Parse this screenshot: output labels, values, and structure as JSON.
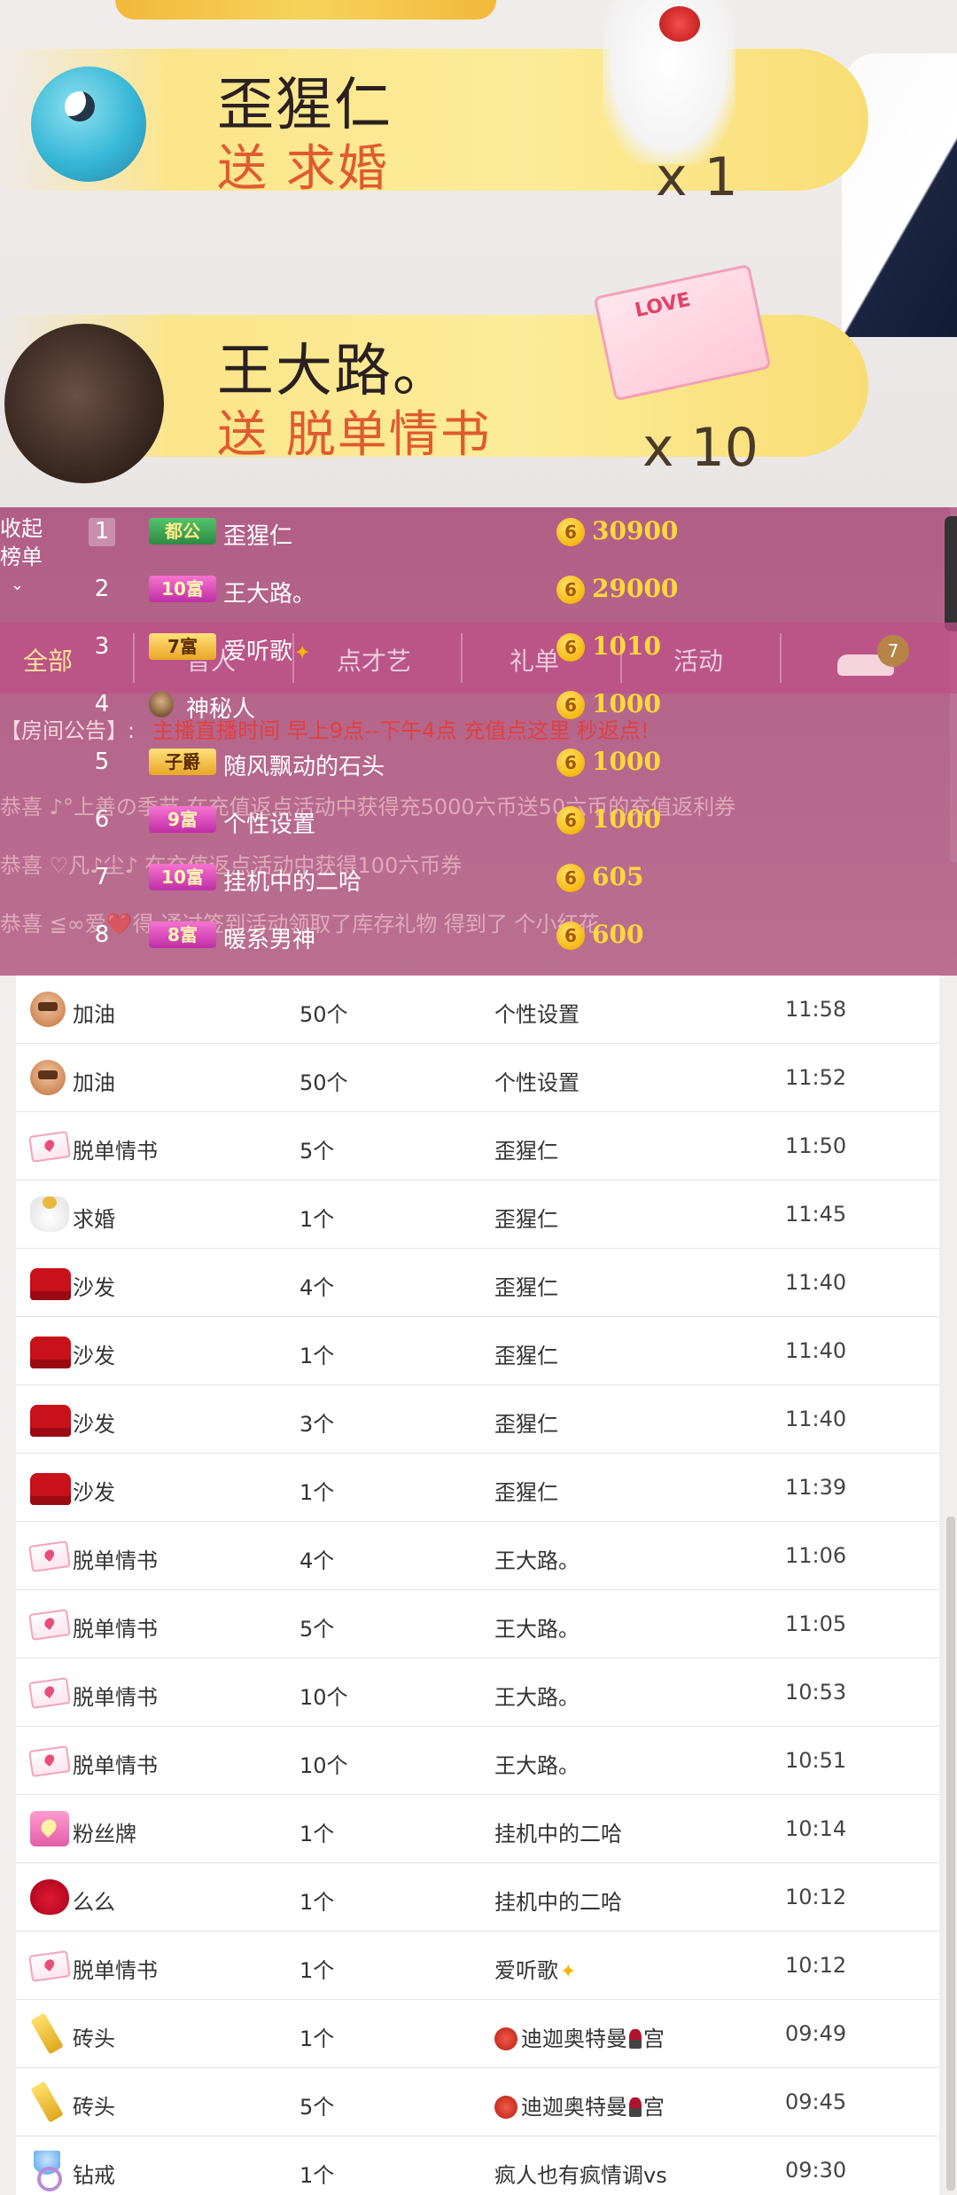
{
  "banners": [
    {
      "name": "歪猩仁",
      "gift": "送 求婚",
      "count": "x 1"
    },
    {
      "name": "王大路。",
      "gift": "送 脱单情书",
      "count": "x 10"
    }
  ],
  "ranking": {
    "collapse_label": "收起榜单",
    "tabs": [
      "全部",
      "普人",
      "点才艺",
      "礼单",
      "活动"
    ],
    "car_badge": "7",
    "announcement_label": "【房间公告】:",
    "announcement_text": "主播直播时间 早上9点--下午4点 充值点这里 秒返点!",
    "rows": [
      {
        "rank": "1",
        "badge": "都公",
        "name": "歪猩仁",
        "value": "30900"
      },
      {
        "rank": "2",
        "badge": "10富",
        "name": "王大路。",
        "value": "29000"
      },
      {
        "rank": "3",
        "badge": "7富",
        "name": "爱听歌",
        "value": "1010"
      },
      {
        "rank": "4",
        "badge": "",
        "name": "神秘人",
        "value": "1000"
      },
      {
        "rank": "5",
        "badge": "子爵",
        "name": "随风飘动的石头",
        "value": "1000"
      },
      {
        "rank": "6",
        "badge": "9富",
        "name": "个性设置",
        "value": "1000"
      },
      {
        "rank": "7",
        "badge": "10富",
        "name": "挂机中的二哈",
        "value": "605"
      },
      {
        "rank": "8",
        "badge": "8富",
        "name": "暖系男神",
        "value": "600"
      }
    ],
    "ghost_lines": [
      "恭喜 ♪°上善の季节 在充值返点活动中获得充5000六币送50六币的充值返利券",
      "恭喜 ♡凡♪尘♪ 在充值返点活动中获得100六币券",
      "恭喜 ≦∞爱❤️得 通过签到活动领取了库存礼物 得到了 个小红花"
    ]
  },
  "gift_log": [
    {
      "icon": "jiayou-icon",
      "gift": "加油",
      "count": "50个",
      "user": "个性设置",
      "time": "11:58"
    },
    {
      "icon": "jiayou-icon",
      "gift": "加油",
      "count": "50个",
      "user": "个性设置",
      "time": "11:52"
    },
    {
      "icon": "love-letter-icon",
      "gift": "脱单情书",
      "count": "5个",
      "user": "歪猩仁",
      "time": "11:50"
    },
    {
      "icon": "proposal-icon",
      "gift": "求婚",
      "count": "1个",
      "user": "歪猩仁",
      "time": "11:45"
    },
    {
      "icon": "sofa-icon",
      "gift": "沙发",
      "count": "4个",
      "user": "歪猩仁",
      "time": "11:40"
    },
    {
      "icon": "sofa-icon",
      "gift": "沙发",
      "count": "1个",
      "user": "歪猩仁",
      "time": "11:40"
    },
    {
      "icon": "sofa-icon",
      "gift": "沙发",
      "count": "3个",
      "user": "歪猩仁",
      "time": "11:40"
    },
    {
      "icon": "sofa-icon",
      "gift": "沙发",
      "count": "1个",
      "user": "歪猩仁",
      "time": "11:39"
    },
    {
      "icon": "love-letter-icon",
      "gift": "脱单情书",
      "count": "4个",
      "user": "王大路。",
      "time": "11:06"
    },
    {
      "icon": "love-letter-icon",
      "gift": "脱单情书",
      "count": "5个",
      "user": "王大路。",
      "time": "11:05"
    },
    {
      "icon": "love-letter-icon",
      "gift": "脱单情书",
      "count": "10个",
      "user": "王大路。",
      "time": "10:53"
    },
    {
      "icon": "love-letter-icon",
      "gift": "脱单情书",
      "count": "10个",
      "user": "王大路。",
      "time": "10:51"
    },
    {
      "icon": "fan-badge-icon",
      "gift": "粉丝牌",
      "count": "1个",
      "user": "挂机中的二哈",
      "time": "10:14"
    },
    {
      "icon": "kiss-icon",
      "gift": "么么",
      "count": "1个",
      "user": "挂机中的二哈",
      "time": "10:12"
    },
    {
      "icon": "love-letter-icon",
      "gift": "脱单情书",
      "count": "1个",
      "user": "爱听歌",
      "time": "10:12"
    },
    {
      "icon": "brick-icon",
      "gift": "砖头",
      "count": "1个",
      "user": "迪迦奥特曼",
      "user_suffix": "宫",
      "time": "09:49"
    },
    {
      "icon": "brick-icon",
      "gift": "砖头",
      "count": "5个",
      "user": "迪迦奥特曼",
      "user_suffix": "宫",
      "time": "09:45"
    },
    {
      "icon": "diamond-ring-icon",
      "gift": "钻戒",
      "count": "1个",
      "user": "疯人也有疯情调vs",
      "time": "09:30"
    }
  ],
  "colors": {
    "ranking_bg": "#a84a78",
    "rank_value": "#ffd83a",
    "banner_gift": "#e05a2f",
    "announcement_text": "#e04040"
  }
}
